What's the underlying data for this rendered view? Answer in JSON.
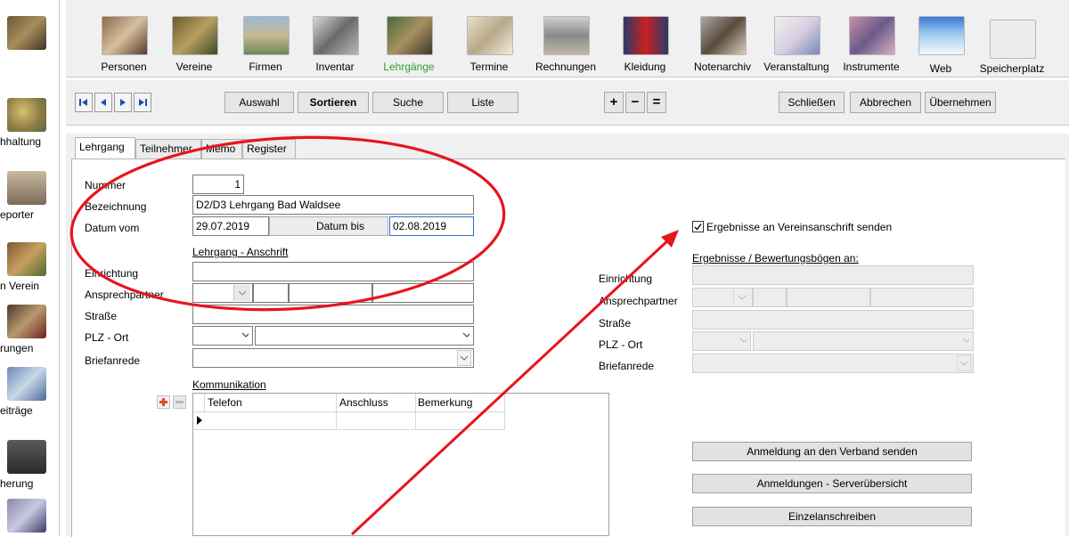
{
  "sidebar": {
    "items": [
      {
        "label": "hhaltung"
      },
      {
        "label": "eporter"
      },
      {
        "label": "n Verein"
      },
      {
        "label": "rungen"
      },
      {
        "label": "eiträge"
      },
      {
        "label": "herung"
      }
    ]
  },
  "toolbar": {
    "items": [
      {
        "label": "Personen",
        "active": false
      },
      {
        "label": "Vereine",
        "active": false
      },
      {
        "label": "Firmen",
        "active": false
      },
      {
        "label": "Inventar",
        "active": false
      },
      {
        "label": "Lehrgänge",
        "active": true
      },
      {
        "label": "Termine",
        "active": false
      },
      {
        "label": "Rechnungen",
        "active": false
      },
      {
        "label": "Kleidung",
        "active": false
      },
      {
        "label": "Notenarchiv",
        "active": false
      },
      {
        "label": "Veranstaltung",
        "active": false
      },
      {
        "label": "Instrumente",
        "active": false
      },
      {
        "label": "Web",
        "active": false
      },
      {
        "label": "Speicherplatz",
        "active": false
      }
    ],
    "active_color": "#2e9d2e"
  },
  "navbar": {
    "auswahl": "Auswahl",
    "sortieren": "Sortieren",
    "suche": "Suche",
    "liste": "Liste",
    "plus": "+",
    "minus": "−",
    "equal": "=",
    "schliessen": "Schließen",
    "abbrechen": "Abbrechen",
    "uebernehmen": "Übernehmen"
  },
  "tabs": [
    {
      "label": "Lehrgang"
    },
    {
      "label": "Teilnehmer"
    },
    {
      "label": "Memo"
    },
    {
      "label": "Register"
    }
  ],
  "form": {
    "nummer_label": "Nummer",
    "nummer_value": "1",
    "bezeichnung_label": "Bezeichnung",
    "bezeichnung_value": "D2/D3 Lehrgang Bad Waldsee",
    "datum_vom_label": "Datum vom",
    "datum_vom_value": "29.07.2019",
    "datum_bis_label": "Datum bis",
    "datum_bis_value": "02.08.2019",
    "anschrift_heading": "Lehrgang - Anschrift",
    "einrichtung_label": "Einrichtung",
    "ansprechpartner_label": "Ansprechpartner",
    "strasse_label": "Straße",
    "plz_ort_label": "PLZ - Ort",
    "briefanrede_label": "Briefanrede",
    "kommunikation_heading": "Kommunikation",
    "grid_columns": [
      "Telefon",
      "Anschluss",
      "Bemerkung"
    ]
  },
  "right": {
    "checkbox_label": "Ergebnisse an Vereinsanschrift senden",
    "checkbox_checked": true,
    "heading": "Ergebnisse / Bewertungsbögen an:",
    "einrichtung_label": "Einrichtung",
    "ansprechpartner_label": "Ansprechpartner",
    "strasse_label": "Straße",
    "plz_ort_label": "PLZ - Ort",
    "briefanrede_label": "Briefanrede",
    "btn_anmeldung": "Anmeldung an den Verband senden",
    "btn_serveruebersicht": "Anmeldungen - Serverübersicht",
    "btn_einzelanschreiben": "Einzelanschreiben"
  },
  "annotation_color": "#e8141c"
}
